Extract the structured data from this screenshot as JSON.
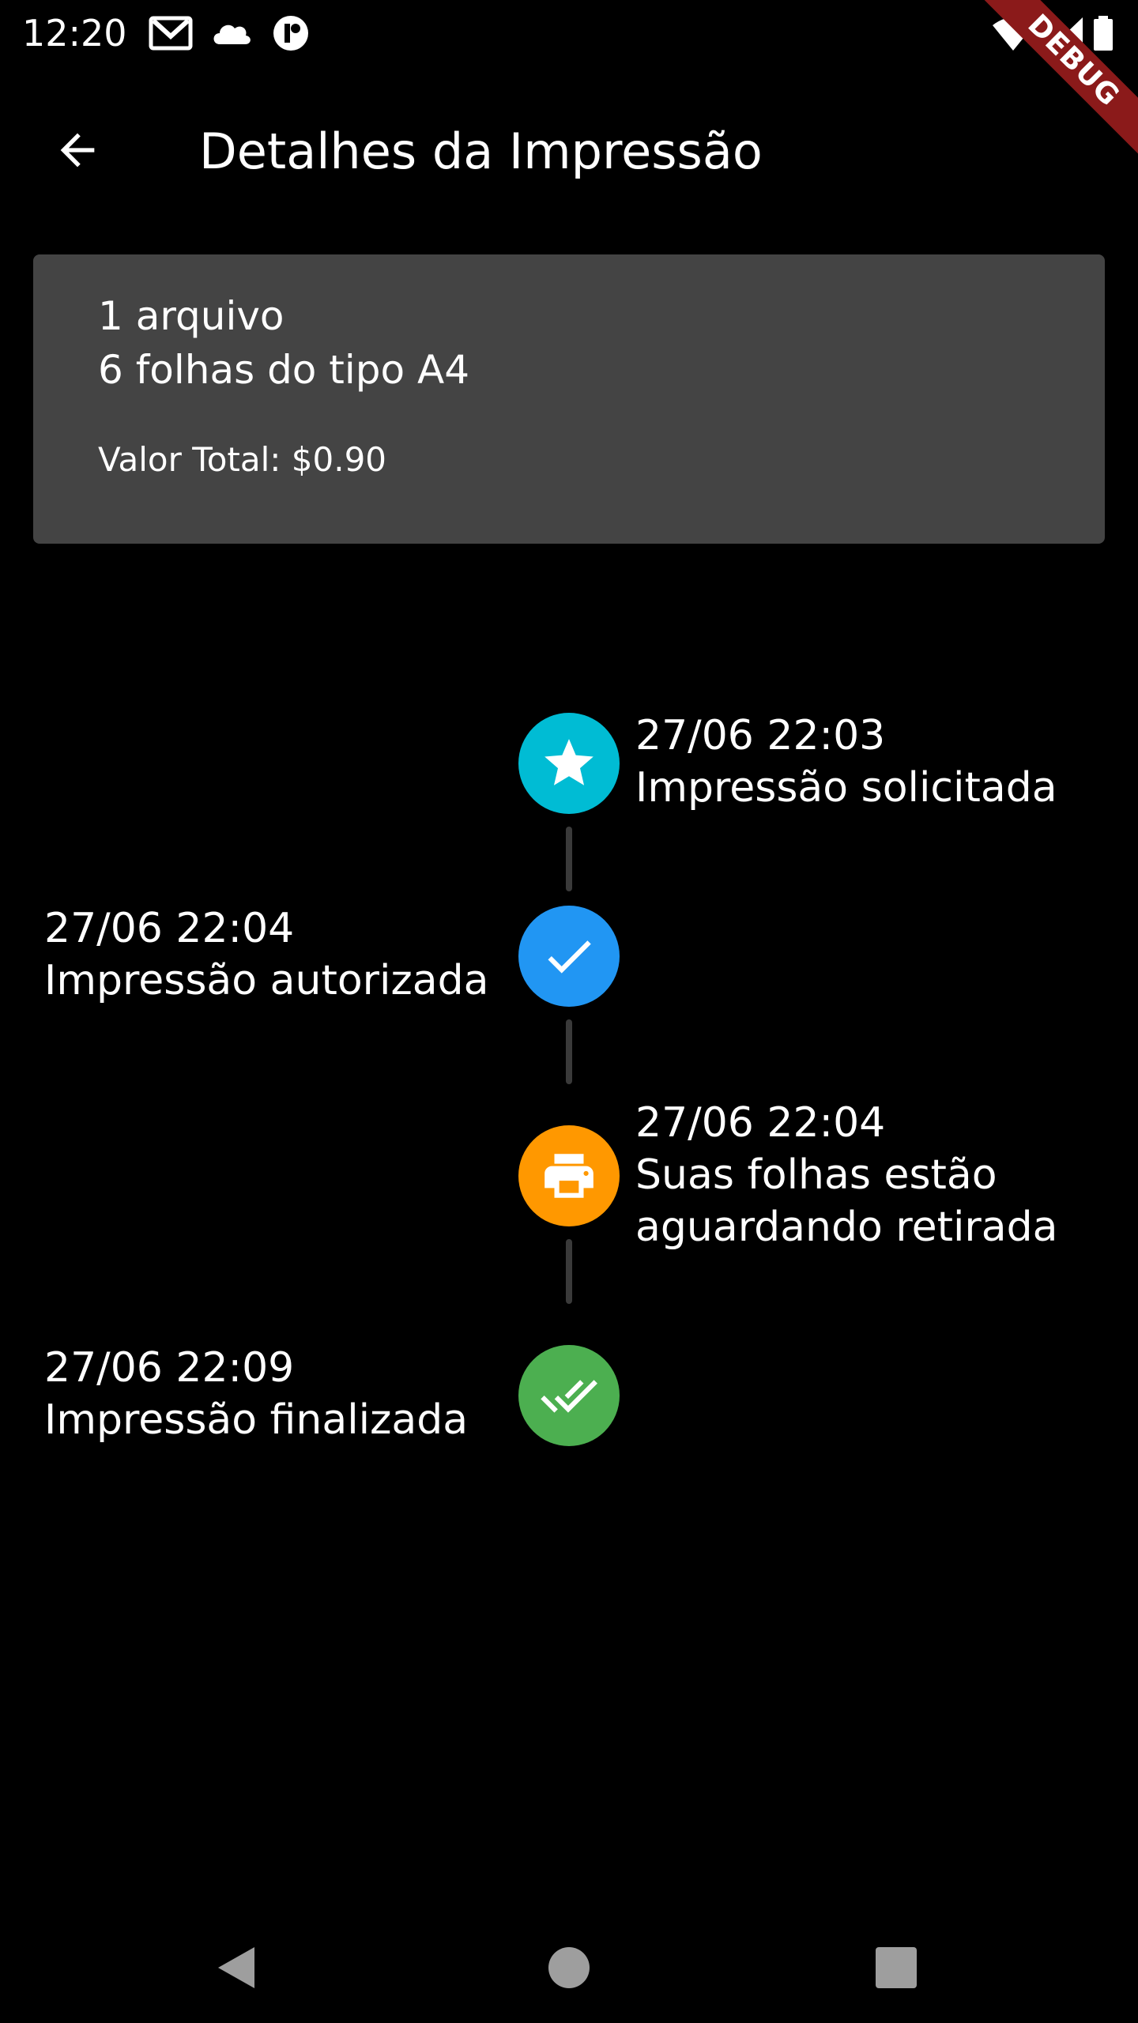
{
  "status_bar": {
    "time": "12:20",
    "icons": [
      "gmail-icon",
      "cloud-icon",
      "app-notification-icon",
      "wifi-icon",
      "signal-icon",
      "battery-icon"
    ],
    "debug_label": "DEBUG"
  },
  "app_bar": {
    "back_icon": "arrow-back-icon",
    "title": "Detalhes da Impressão"
  },
  "summary": {
    "files": "1 arquivo",
    "sheets": "6 folhas do tipo A4",
    "total": "Valor Total: $0.90",
    "background_color": "#444444"
  },
  "timeline": [
    {
      "timestamp": "27/06 22:03",
      "label": "Impressão solicitada",
      "label_line2": "",
      "icon": "star-icon",
      "color": "#00BCD4",
      "side": "right"
    },
    {
      "timestamp": "27/06 22:04",
      "label": "Impressão autorizada",
      "label_line2": "",
      "icon": "check-icon",
      "color": "#2196F3",
      "side": "left"
    },
    {
      "timestamp": "27/06 22:04",
      "label": "Suas folhas estão",
      "label_line2": "aguardando retirada",
      "icon": "printer-icon",
      "color": "#FF9800",
      "side": "right"
    },
    {
      "timestamp": "27/06 22:09",
      "label": "Impressão finalizada",
      "label_line2": "",
      "icon": "done-all-icon",
      "color": "#4CAF50",
      "side": "left"
    }
  ],
  "nav_bar": {
    "back_icon": "nav-back-icon",
    "home_icon": "nav-home-icon",
    "recents_icon": "nav-recents-icon",
    "color": "#9e9e9e"
  }
}
